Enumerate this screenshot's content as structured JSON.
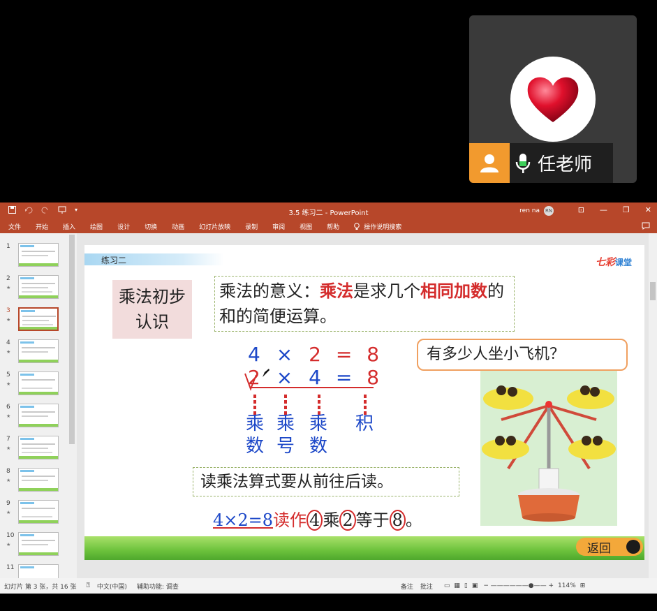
{
  "video": {
    "participant_name": "任老师",
    "avatar_icon": "heart-icon"
  },
  "ppt": {
    "qat_icons": [
      "save-icon",
      "undo-icon",
      "redo-icon",
      "present-icon",
      "customize-icon"
    ],
    "title": "3.5 练习二  -  PowerPoint",
    "user_name": "ren na",
    "user_initials": "RN",
    "ribbon_tabs": [
      "文件",
      "开始",
      "插入",
      "绘图",
      "设计",
      "切换",
      "动画",
      "幻灯片放映",
      "录制",
      "审阅",
      "视图",
      "帮助"
    ],
    "tell_me": "操作说明搜索",
    "thumbnails": [
      "1",
      "2",
      "3",
      "4",
      "5",
      "6",
      "7",
      "8",
      "9",
      "10",
      "11"
    ],
    "active_slide": "3",
    "slide": {
      "header": "练习二",
      "brand_part1": "七彩",
      "brand_part2": "课堂",
      "concept": "乘法初步认识",
      "definition_prefix": "乘法的意义：",
      "definition_red1": "乘法",
      "definition_mid": "是求几个",
      "definition_red2": "相同加数",
      "definition_suffix": "的和的简便运算。",
      "eq1": {
        "a": "4",
        "op": "×",
        "b": "2",
        "eq": "=",
        "r": "8"
      },
      "eq2": {
        "a": "2",
        "op": "×",
        "b": "4",
        "eq": "=",
        "r": "8"
      },
      "term1": "乘数",
      "term2": "乘号",
      "term3": "乘数",
      "term4": "积",
      "read_rule": "读乘法算式要从前往后读。",
      "read_expr": "4×2=8",
      "read_as": "读作",
      "read_n1": "4",
      "read_mul": "乘",
      "read_n2": "2",
      "read_eq": "等于",
      "read_n3": "8",
      "read_end": "。",
      "question": "有多少人坐小飞机？",
      "back": "返回"
    },
    "status": {
      "slide_info": "幻灯片 第 3 张，共 16 张",
      "language": "中文(中国)",
      "accessibility": "辅助功能: 调查",
      "notes": "备注",
      "comments": "批注",
      "zoom": "114%"
    }
  }
}
